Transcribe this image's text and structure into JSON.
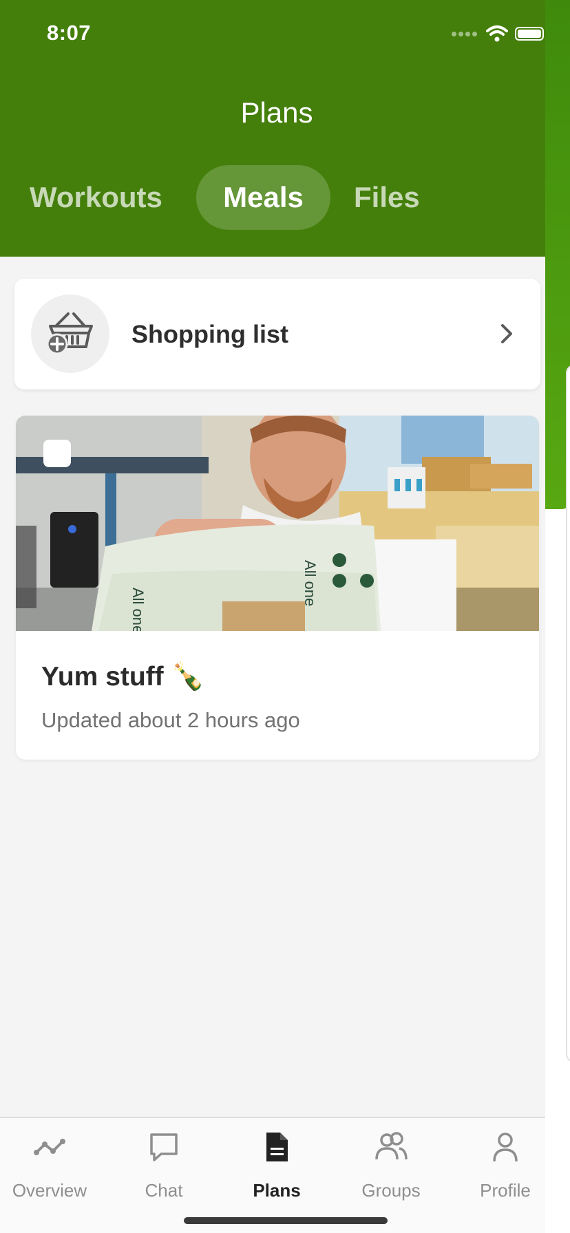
{
  "status_bar": {
    "time": "8:07"
  },
  "header": {
    "title": "Plans",
    "tabs": [
      {
        "label": "Workouts",
        "active": false
      },
      {
        "label": "Meals",
        "active": true
      },
      {
        "label": "Files",
        "active": false
      }
    ]
  },
  "shopping_list": {
    "label": "Shopping list",
    "icon": "basket-add-icon"
  },
  "meal_plans": [
    {
      "title": "Yum stuff 🍾",
      "updated": "Updated about 2 hours ago",
      "image": "person holding crispbread bag in office"
    }
  ],
  "bottom_nav": [
    {
      "label": "Overview",
      "icon": "overview-icon",
      "active": false
    },
    {
      "label": "Chat",
      "icon": "chat-icon",
      "active": false
    },
    {
      "label": "Plans",
      "icon": "plans-icon",
      "active": true
    },
    {
      "label": "Groups",
      "icon": "groups-icon",
      "active": false
    },
    {
      "label": "Profile",
      "icon": "profile-icon",
      "active": false
    }
  ],
  "colors": {
    "brand_green": "#447f0b",
    "active_text": "#222222",
    "inactive_text": "#8e8e8e"
  }
}
